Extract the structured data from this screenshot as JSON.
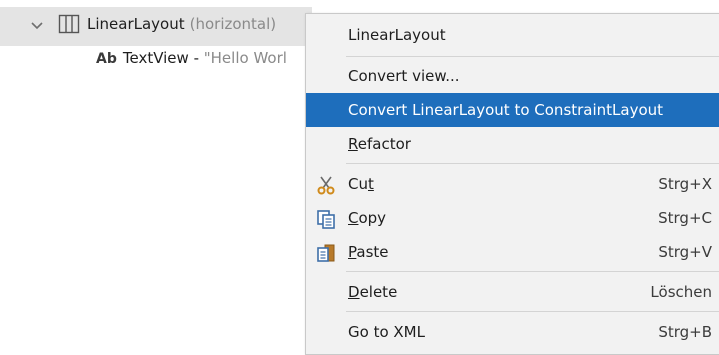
{
  "tree": {
    "root": {
      "name": "LinearLayout",
      "kind": "(horizontal)"
    },
    "child": {
      "icon_text": "Ab",
      "name": "TextView",
      "separator": " - ",
      "text": "\"Hello Worl"
    }
  },
  "menu": {
    "items": [
      {
        "label": "LinearLayout",
        "has_submenu": true
      },
      {
        "label": "Convert view..."
      },
      {
        "label": "Convert LinearLayout to ConstraintLayout",
        "highlighted": true
      },
      {
        "label": "Refactor",
        "mnemonic": "R",
        "rest": "efactor",
        "has_submenu": true
      },
      {
        "label": "Cut",
        "pre": "Cu",
        "mnemonic": "t",
        "shortcut": "Strg+X",
        "icon": "scissors-icon"
      },
      {
        "label": "Copy",
        "mnemonic": "C",
        "rest": "opy",
        "shortcut": "Strg+C",
        "icon": "copy-icon"
      },
      {
        "label": "Paste",
        "mnemonic": "P",
        "rest": "aste",
        "shortcut": "Strg+V",
        "icon": "paste-icon"
      },
      {
        "label": "Delete",
        "mnemonic": "D",
        "rest": "elete",
        "shortcut": "Löschen"
      },
      {
        "label": "Go to XML",
        "shortcut": "Strg+B"
      }
    ]
  },
  "colors": {
    "highlight": "#1e6ebc",
    "menu_bg": "#f2f2f2",
    "selected_row": "#e4e4e4"
  }
}
